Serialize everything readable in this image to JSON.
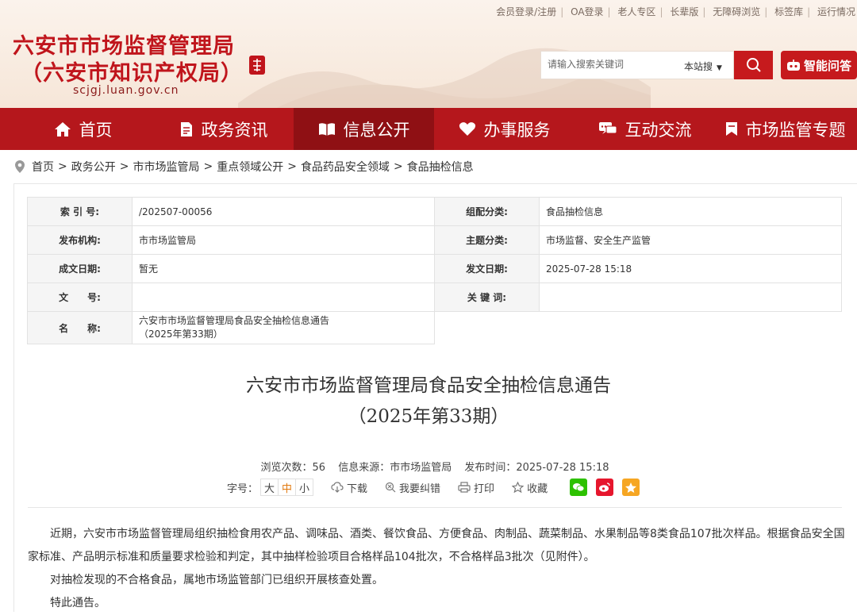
{
  "top_links": [
    "会员登录/注册",
    "OA登录",
    "老人专区",
    "长辈版",
    "无障碍浏览",
    "标签库",
    "运行情况"
  ],
  "header": {
    "title_line1": "六安市市场监督管理局",
    "title_line2": "（六安市知识产权局）",
    "domain": "scjgj.luan.gov.cn"
  },
  "search": {
    "placeholder": "请输入搜索关键词",
    "scope": "本站搜",
    "ai_label": "智能问答"
  },
  "nav": [
    {
      "label": "首页",
      "icon": "home-icon"
    },
    {
      "label": "政务资讯",
      "icon": "document-icon"
    },
    {
      "label": "信息公开",
      "icon": "book-icon",
      "active": true
    },
    {
      "label": "办事服务",
      "icon": "heart-icon"
    },
    {
      "label": "互动交流",
      "icon": "chat-icon"
    },
    {
      "label": "市场监管专题",
      "icon": "bookmark-icon"
    }
  ],
  "breadcrumb": [
    "首页",
    "政务公开",
    "市市场监管局",
    "重点领域公开",
    "食品药品安全领域",
    "食品抽检信息"
  ],
  "meta": {
    "index_label": "索 引 号:",
    "index_value": "/202507-00056",
    "category_label": "组配分类:",
    "category_value": "食品抽检信息",
    "publisher_label": "发布机构:",
    "publisher_value": "市市场监管局",
    "topic_label": "主题分类:",
    "topic_value": "市场监督、安全生产监管",
    "created_label": "成文日期:",
    "created_value": "暂无",
    "issued_label": "发文日期:",
    "issued_value": "2025-07-28 15:18",
    "docno_label": "文　　号:",
    "docno_value": "",
    "keyword_label": "关 键 词:",
    "keyword_value": "",
    "name_label": "名　　称:",
    "name_value_line1": "六安市市场监督管理局食品安全抽检信息通告",
    "name_value_line2": "（2025年第33期）"
  },
  "document": {
    "title_line1": "六安市市场监督管理局食品安全抽检信息通告",
    "title_line2": "（2025年第33期）",
    "views": "浏览次数：56",
    "source": "信息来源：市市场监管局",
    "time": "发布时间：2025-07-28 15:18",
    "font_size_label": "字号：",
    "font_sizes": [
      "大",
      "中",
      "小"
    ],
    "download": "下载",
    "correction": "我要纠错",
    "print": "打印",
    "favorite": "收藏",
    "paragraphs": [
      "近期，六安市市场监督管理局组织抽检食用农产品、调味品、酒类、餐饮食品、方便食品、肉制品、蔬菜制品、水果制品等8类食品107批次样品。根据食品安全国家标准、产品明示标准和质量要求检验和判定，其中抽样检验项目合格样品104批次，不合格样品3批次（见附件）。",
      "对抽检发现的不合格食品，属地市场监管部门已组织开展核查处置。",
      "特此通告。"
    ]
  },
  "colors": {
    "brand_red": "#b5171c",
    "nav_active": "#8f1014",
    "wechat": "#2dc100",
    "weibo": "#e6162d",
    "qzone": "#f6a623"
  }
}
